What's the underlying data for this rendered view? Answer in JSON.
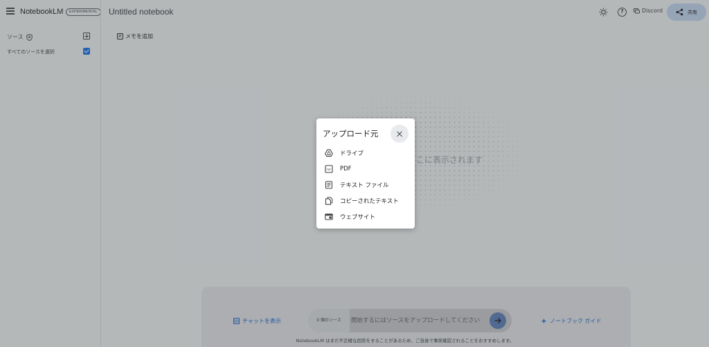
{
  "header": {
    "logo": "NotebookLM",
    "badge": "EXPERIMENTAL",
    "notebook_title": "Untitled notebook",
    "discord_label": "Discord",
    "share_label": "共有"
  },
  "sidebar": {
    "sources_label": "ソース",
    "select_all_label": "すべてのソースを選択",
    "select_all_checked": true
  },
  "main": {
    "add_note_label": "メモを追加",
    "empty_text": "こに表示されます"
  },
  "chat": {
    "show_chat_label": "チャットを表示",
    "source_count": "0 個のソース",
    "input_placeholder": "開始するにはソースをアップロードしてください",
    "notebook_guide_label": "ノートブック ガイド",
    "disclaimer": "NotebookLM はまだ不正確な回答をすることがあるため、ご自身で事実確認されることをおすすめします。"
  },
  "dialog": {
    "title": "アップロード元",
    "options": [
      {
        "label": "ドライブ",
        "icon": "drive-icon"
      },
      {
        "label": "PDF",
        "icon": "pdf-icon"
      },
      {
        "label": "テキスト ファイル",
        "icon": "text-file-icon"
      },
      {
        "label": "コピーされたテキスト",
        "icon": "copy-icon"
      },
      {
        "label": "ウェブサイト",
        "icon": "website-icon"
      }
    ]
  },
  "colors": {
    "accent": "#1a73e8",
    "share_button": "#c2d6f0",
    "send_button": "#5b7fb8"
  }
}
